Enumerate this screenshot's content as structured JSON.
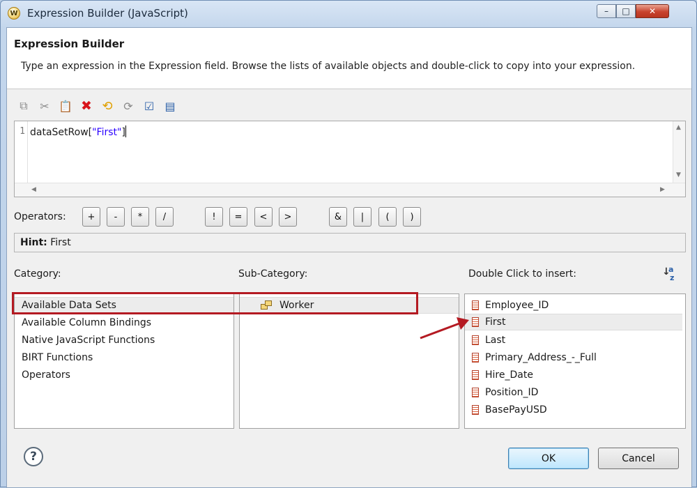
{
  "window": {
    "title": "Expression Builder (JavaScript)",
    "icon_letter": "W",
    "controls": {
      "minimize": "–",
      "maximize": "□",
      "close": "✕"
    }
  },
  "banner": {
    "title": "Expression Builder",
    "description": "Type an expression in the Expression field. Browse the lists of available objects and double-click to copy into your expression."
  },
  "toolbar": {
    "icons": [
      "copy-icon",
      "cut-icon",
      "paste-icon",
      "delete-icon",
      "undo-icon",
      "redo-icon",
      "validate-icon",
      "calculate-icon"
    ]
  },
  "editor": {
    "line_number": "1",
    "code_prefix": "dataSetRow[",
    "code_string": "\"First\"",
    "code_suffix": "]"
  },
  "operators": {
    "label": "Operators:",
    "buttons": [
      "+",
      "-",
      "*",
      "/",
      "!",
      "=",
      "<",
      ">",
      "&",
      "|",
      "(",
      ")"
    ]
  },
  "hint": {
    "label": "Hint:",
    "value": "First"
  },
  "category": {
    "label": "Category:",
    "items": [
      "Available Data Sets",
      "Available Column Bindings",
      "Native JavaScript Functions",
      "BIRT Functions",
      "Operators"
    ],
    "selected": "Available Data Sets"
  },
  "subcategory": {
    "label": "Sub-Category:",
    "items": [
      "Worker"
    ]
  },
  "insert": {
    "label": "Double Click to insert:",
    "items": [
      "Employee_ID",
      "First",
      "Last",
      "Primary_Address_-_Full",
      "Hire_Date",
      "Position_ID",
      "BasePayUSD"
    ],
    "selected": "First",
    "sort_letters": [
      "a",
      "z"
    ]
  },
  "buttons": {
    "help": "?",
    "ok": "OK",
    "cancel": "Cancel"
  },
  "colors": {
    "annotation": "#b41a22",
    "string_literal": "#2a00ff",
    "ok_border": "#3c7fb1"
  }
}
